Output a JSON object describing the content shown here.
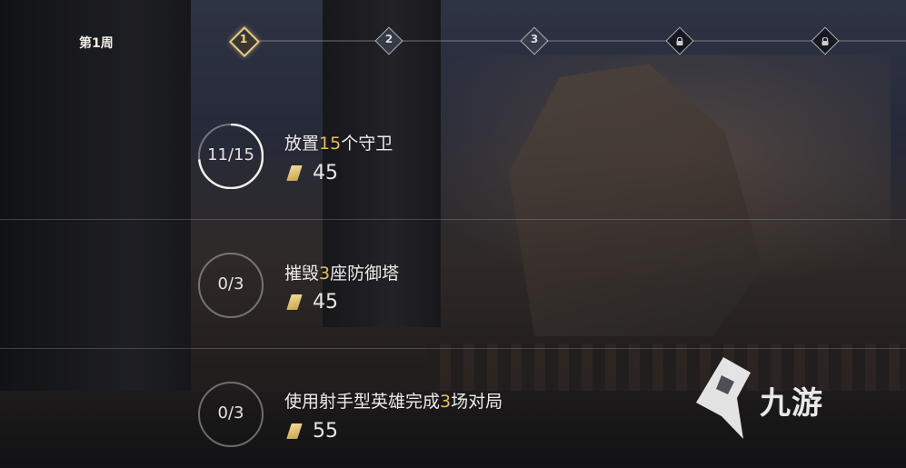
{
  "header": {
    "week_label": "第1周",
    "stages": [
      {
        "label": "1",
        "state": "active"
      },
      {
        "label": "2",
        "state": "available"
      },
      {
        "label": "3",
        "state": "available"
      },
      {
        "label": "",
        "state": "locked",
        "icon": "lock-icon"
      },
      {
        "label": "",
        "state": "locked",
        "icon": "lock-icon"
      }
    ]
  },
  "tasks": [
    {
      "progress": "11/15",
      "progress_fraction": 0.733,
      "text_before": "放置",
      "highlight": "15",
      "text_after": "个守卫",
      "reward_icon": "gold-bar-icon",
      "reward": "45"
    },
    {
      "progress": "0/3",
      "progress_fraction": 0,
      "text_before": "摧毁",
      "highlight": "3",
      "text_after": "座防御塔",
      "reward_icon": "gold-bar-icon",
      "reward": "45"
    },
    {
      "progress": "0/3",
      "progress_fraction": 0,
      "text_before": "使用射手型英雄完成",
      "highlight": "3",
      "text_after": "场对局",
      "reward_icon": "gold-bar-icon",
      "reward": "55"
    }
  ],
  "watermark": {
    "text": "九游"
  },
  "colors": {
    "highlight": "#e5bd62",
    "active_node": "#e4cc86"
  }
}
